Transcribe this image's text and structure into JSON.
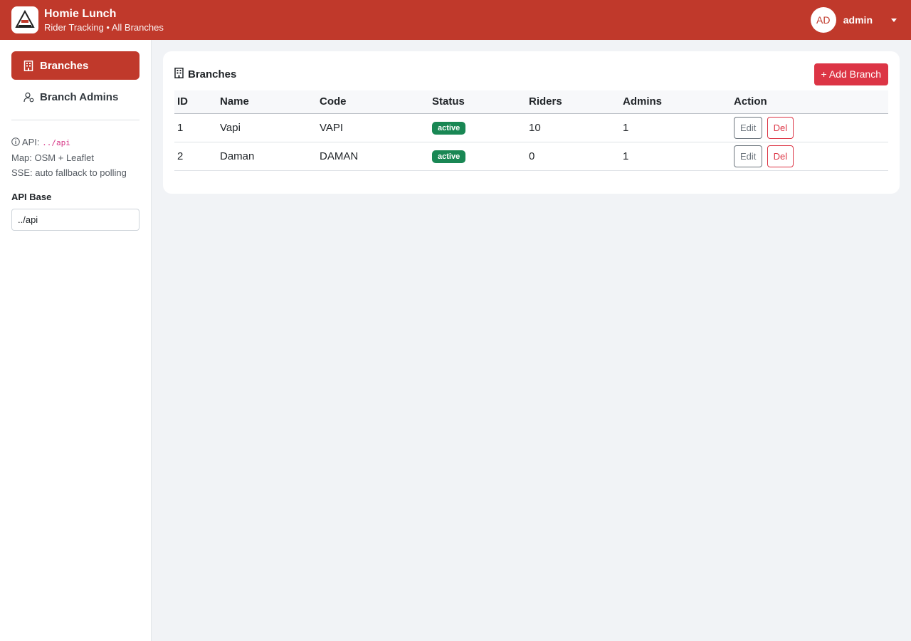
{
  "header": {
    "title": "Homie Lunch",
    "subtitle": "Rider Tracking • All Branches",
    "user_initials": "AD",
    "user_name": "admin"
  },
  "sidebar": {
    "items": [
      {
        "label": "Branches",
        "icon": "building-icon",
        "active": true
      },
      {
        "label": "Branch Admins",
        "icon": "user-gear-icon",
        "active": false
      }
    ],
    "info": {
      "api_prefix": "API:",
      "api_value": "../api",
      "map": "Map: OSM + Leaflet",
      "sse": "SSE: auto fallback to polling"
    },
    "api_base_label": "API Base",
    "api_base_value": "../api"
  },
  "main": {
    "title": "Branches",
    "add_button": "+ Add Branch",
    "columns": [
      "ID",
      "Name",
      "Code",
      "Status",
      "Riders",
      "Admins",
      "Action"
    ],
    "rows": [
      {
        "id": "1",
        "name": "Vapi",
        "code": "VAPI",
        "status": "active",
        "riders": "10",
        "admins": "1",
        "edit": "Edit",
        "del": "Del"
      },
      {
        "id": "2",
        "name": "Daman",
        "code": "DAMAN",
        "status": "active",
        "riders": "0",
        "admins": "1",
        "edit": "Edit",
        "del": "Del"
      }
    ]
  },
  "colors": {
    "brand": "#c0392b",
    "danger": "#dc3545",
    "success": "#198754"
  }
}
